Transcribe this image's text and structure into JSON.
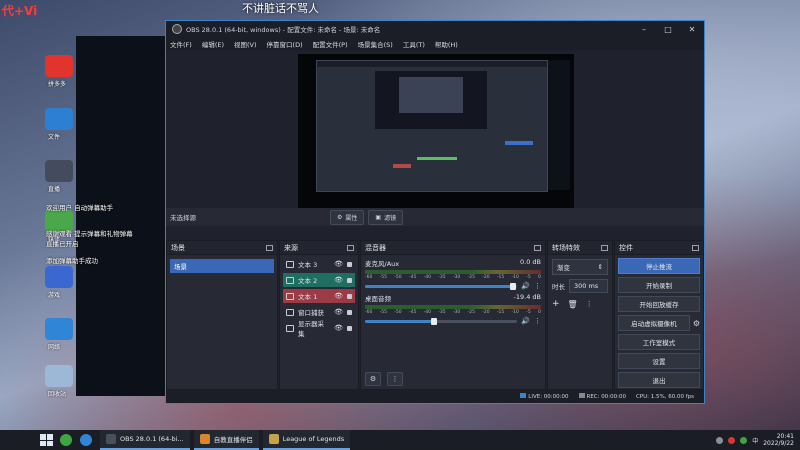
{
  "overlay": {
    "watermark": "代+Vi",
    "top_text": "不讲脏话不骂人",
    "notify_lines": [
      "欢迎用户 自动弹幕助手",
      "感谢观看 提示弹幕和礼物弹幕",
      "直播已开启",
      "添加弹幕助手成功"
    ]
  },
  "desktop": {
    "icons": [
      {
        "name": "pinduoduo-icon",
        "label": "拼多多",
        "color": "#e0342c"
      },
      {
        "name": "files-icon",
        "label": "文件",
        "color": "#2d7fd3"
      },
      {
        "name": "app-icon",
        "label": "直播",
        "color": "#444b5c"
      },
      {
        "name": "media-icon",
        "label": "媒体",
        "color": "#4aa84b"
      },
      {
        "name": "game-icon",
        "label": "游戏",
        "color": "#3b67d1"
      },
      {
        "name": "network-icon",
        "label": "网络",
        "color": "#2f86d7"
      },
      {
        "name": "recycle-bin-icon",
        "label": "回收站",
        "color": "#9db7d6"
      }
    ]
  },
  "obs": {
    "title": "OBS 28.0.1 (64-bit, windows) - 配置文件: 未命名 - 场景: 未命名",
    "menu": [
      "文件(F)",
      "编辑(E)",
      "视图(V)",
      "停靠窗口(D)",
      "配置文件(P)",
      "场景集合(S)",
      "工具(T)",
      "帮助(H)"
    ],
    "source_toolbar": {
      "no_selection": "未选择源",
      "properties": "属性",
      "filters": "滤镜"
    },
    "docks": {
      "scenes": {
        "title": "场景",
        "items": [
          "场景"
        ]
      },
      "sources": {
        "title": "来源",
        "items": [
          {
            "label": "文本 3",
            "state": "normal"
          },
          {
            "label": "文本 2",
            "state": "green"
          },
          {
            "label": "文本 1",
            "state": "red"
          },
          {
            "label": "窗口捕获",
            "state": "normal"
          },
          {
            "label": "显示器采集",
            "state": "normal"
          }
        ]
      },
      "mixer": {
        "title": "混音器",
        "ticks": [
          "-60",
          "-55",
          "-50",
          "-45",
          "-40",
          "-35",
          "-30",
          "-25",
          "-20",
          "-15",
          "-10",
          "-5",
          "0"
        ],
        "channels": [
          {
            "name": "麦克风/Aux",
            "db": "0.0 dB",
            "level": 0.97
          },
          {
            "name": "桌面音频",
            "db": "-19.4 dB",
            "level": 0.45
          }
        ]
      },
      "transitions": {
        "title": "转场特效",
        "type": "渐变",
        "duration_label": "时长",
        "duration": "300 ms"
      },
      "controls": {
        "title": "控件",
        "buttons": [
          "停止推流",
          "开始录制",
          "开始回放缓存",
          "启动虚拟摄像机",
          "工作室模式",
          "设置",
          "退出"
        ]
      }
    },
    "status": {
      "live": "LIVE: 00:00:00",
      "rec": "REC: 00:00:00",
      "cpu": "CPU: 1.5%, 60.00 fps"
    }
  },
  "taskbar": {
    "tasks": [
      {
        "label": "OBS 28.0.1 (64-bi...",
        "color": "#4a4f5c"
      },
      {
        "label": "自教直播伴侣",
        "color": "#d9862c"
      },
      {
        "label": "League of Legends",
        "color": "#c8a24a"
      }
    ],
    "tray_text": "中",
    "time": "20:41",
    "date": "2022/9/22"
  }
}
